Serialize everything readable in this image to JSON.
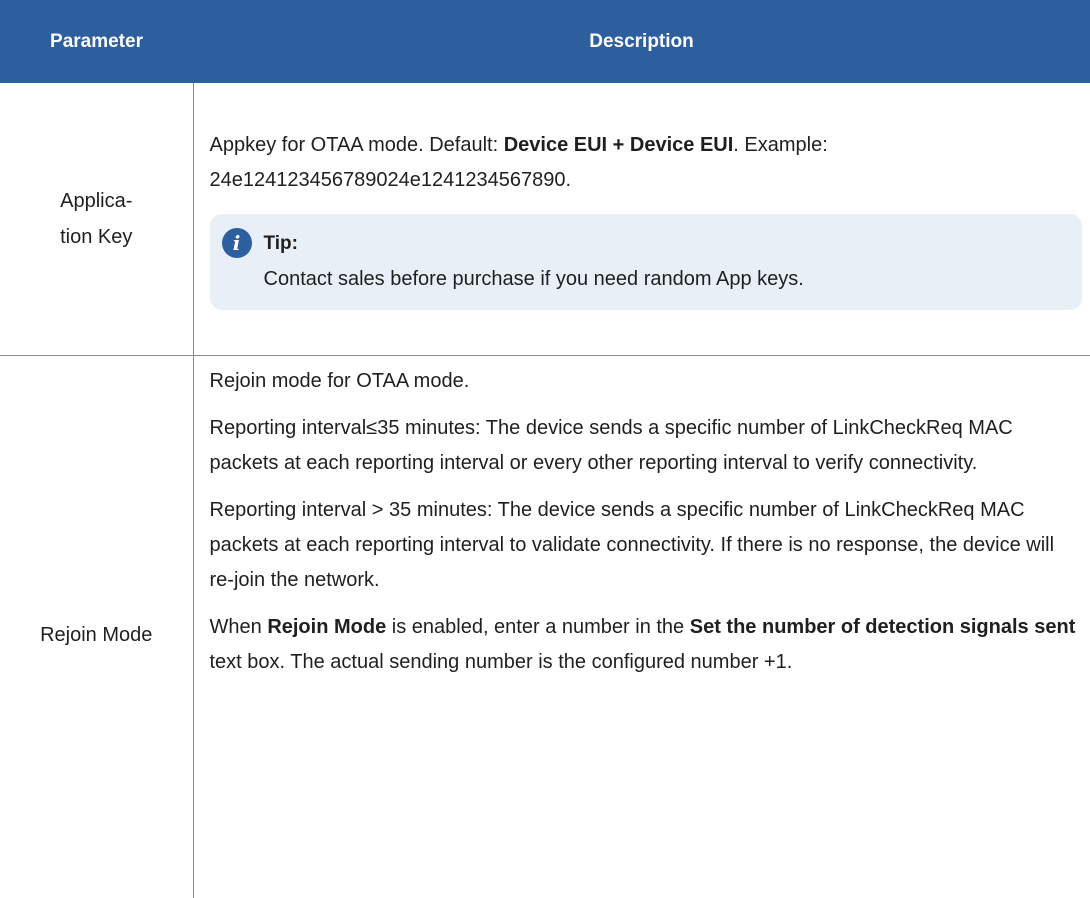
{
  "header": {
    "parameter": "Parameter",
    "description": "Description"
  },
  "rows": [
    {
      "param_line1": "Applica-",
      "param_line2": "tion Key",
      "desc_a": "Appkey for OTAA mode. Default: ",
      "desc_bold": "Device EUI + Device EUI",
      "desc_b": ". Example: 24e124123456789024e1241234567890.",
      "tip_label": "Tip:",
      "tip_text": "Contact sales before purchase if you need random App keys."
    },
    {
      "param": "Rejoin Mode",
      "p1": "Rejoin mode for OTAA mode.",
      "p2": "Reporting interval≤35 minutes: The device sends a specific number of LinkCheckReq MAC packets at each reporting interval or every other re­porting interval to verify connectivity.",
      "p3": "Reporting interval > 35 minutes: The device sends a specific number of LinkCheckReq MAC packets at each reporting interval to validate connec­tivity. If there is no response, the device will re-join the network.",
      "p4_a": "When ",
      "p4_bold1": "Rejoin Mode",
      "p4_b": " is enabled, enter a number in the ",
      "p4_bold2": "Set the number of detection signals sent",
      "p4_c": " text box. The actual sending number is the config­ured number +1."
    }
  ],
  "colors": {
    "header_bg": "#2d5f9f",
    "tip_bg": "#e9eff6",
    "icon_bg": "#2d5f9f"
  },
  "icons": {
    "tip": "info-icon"
  }
}
